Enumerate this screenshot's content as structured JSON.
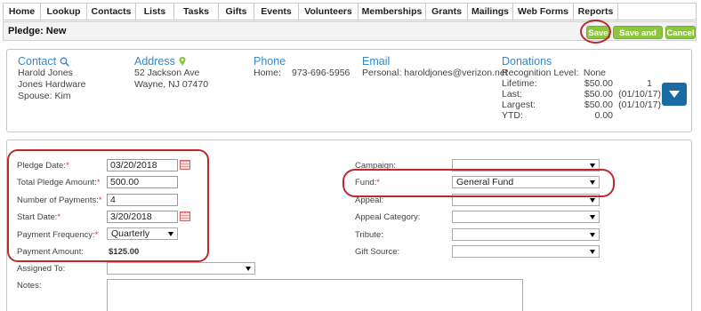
{
  "nav": {
    "items": [
      {
        "label": "Home"
      },
      {
        "label": "Lookup"
      },
      {
        "label": "Contacts"
      },
      {
        "label": "Lists"
      },
      {
        "label": "Tasks"
      },
      {
        "label": "Gifts"
      },
      {
        "label": "Events"
      },
      {
        "label": "Volunteers"
      },
      {
        "label": "Memberships"
      },
      {
        "label": "Grants"
      },
      {
        "label": "Mailings"
      },
      {
        "label": "Web Forms"
      },
      {
        "label": "Reports"
      }
    ]
  },
  "titlebar": {
    "title": "Pledge: New",
    "save_label": "Save",
    "save_exit_label": "Save and Exit",
    "cancel_label": "Cancel"
  },
  "contact": {
    "heading": "Contact",
    "name": "Harold Jones",
    "company": "Jones Hardware",
    "spouse": "Spouse: Kim"
  },
  "address": {
    "heading": "Address",
    "line1": "52 Jackson Ave",
    "line2": "Wayne, NJ 07470"
  },
  "phone": {
    "heading": "Phone",
    "type": "Home:",
    "number": "973-696-5956"
  },
  "email": {
    "heading": "Email",
    "value": "Personal: haroldjones@verizon.net"
  },
  "donations": {
    "heading": "Donations",
    "rows": [
      {
        "label": "Recognition Level:",
        "amount": "None",
        "extra": ""
      },
      {
        "label": "Lifetime:",
        "amount": "$50.00",
        "extra": "1"
      },
      {
        "label": "Last:",
        "amount": "$50.00",
        "extra": "(01/10/17)"
      },
      {
        "label": "Largest:",
        "amount": "$50.00",
        "extra": "(01/10/17)"
      },
      {
        "label": "YTD:",
        "amount": "0.00",
        "extra": ""
      }
    ]
  },
  "form": {
    "pledge_date": {
      "label": "Pledge Date:",
      "value": "03/20/2018"
    },
    "total_amount": {
      "label": "Total Pledge Amount:",
      "value": "500.00"
    },
    "num_payments": {
      "label": "Number of Payments:",
      "value": "4"
    },
    "start_date": {
      "label": "Start Date:",
      "value": "3/20/2018"
    },
    "payment_frequency": {
      "label": "Payment Frequency:",
      "value": "Quarterly"
    },
    "payment_amount": {
      "label": "Payment Amount:",
      "value": "$125.00"
    },
    "assigned_to": {
      "label": "Assigned To:",
      "value": ""
    },
    "notes": {
      "label": "Notes:"
    },
    "campaign": {
      "label": "Campaign:",
      "value": ""
    },
    "fund": {
      "label": "Fund:",
      "value": "General Fund"
    },
    "appeal": {
      "label": "Appeal:",
      "value": ""
    },
    "appeal_category": {
      "label": "Appeal Category:",
      "value": ""
    },
    "tribute": {
      "label": "Tribute:",
      "value": ""
    },
    "gift_source": {
      "label": "Gift Source:",
      "value": ""
    }
  },
  "colors": {
    "accent_blue": "#3b86c6",
    "green_button": "#8cc63f",
    "highlight_red": "#c1272d",
    "dropdown_button": "#1a6aa3"
  }
}
